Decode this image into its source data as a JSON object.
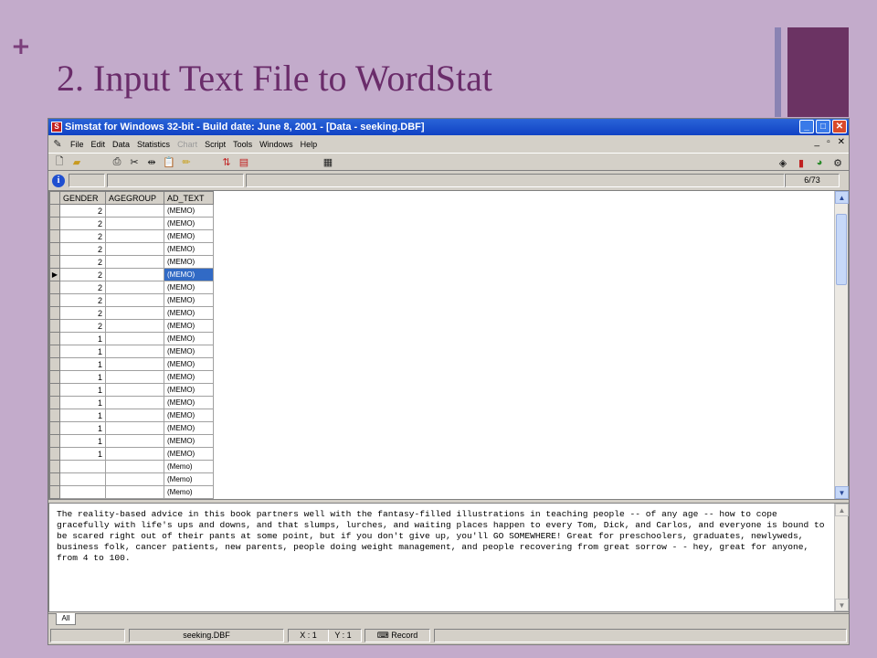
{
  "slide": {
    "plus": "+",
    "title": "2. Input Text File to WordStat"
  },
  "window": {
    "title": "Simstat for Windows 32-bit - Build date: June 8, 2001 - [Data - seeking.DBF]",
    "min": "_",
    "max": "□",
    "close": "✕"
  },
  "menu": [
    {
      "label": "File",
      "disabled": false
    },
    {
      "label": "Edit",
      "disabled": false
    },
    {
      "label": "Data",
      "disabled": false
    },
    {
      "label": "Statistics",
      "disabled": false
    },
    {
      "label": "Chart",
      "disabled": true
    },
    {
      "label": "Script",
      "disabled": false
    },
    {
      "label": "Tools",
      "disabled": false
    },
    {
      "label": "Windows",
      "disabled": false
    },
    {
      "label": "Help",
      "disabled": false
    }
  ],
  "mdi": {
    "min": "_",
    "restore": "▫",
    "close": "✕"
  },
  "toolbar": {
    "left_icons": [
      "new-file-icon",
      "open-folder-icon",
      "print-icon",
      "cut-icon",
      "split-icon",
      "paste-icon",
      "edit-icon",
      "sort-icon",
      "filter-icon",
      "table-icon"
    ],
    "right_icons": [
      "eraser-icon",
      "book-icon",
      "chart-icon",
      "settings-icon"
    ]
  },
  "info": {
    "icon": "i",
    "count": "6/73"
  },
  "grid": {
    "columns": [
      "GENDER",
      "AGEGROUP",
      "AD_TEXT"
    ],
    "current_row": 6,
    "selected_cell": {
      "row": 6,
      "col": "AD_TEXT"
    },
    "rows": [
      {
        "gender": "2",
        "agegroup": "",
        "ad_text": "(MEMO)"
      },
      {
        "gender": "2",
        "agegroup": "",
        "ad_text": "(MEMO)"
      },
      {
        "gender": "2",
        "agegroup": "",
        "ad_text": "(MEMO)"
      },
      {
        "gender": "2",
        "agegroup": "",
        "ad_text": "(MEMO)"
      },
      {
        "gender": "2",
        "agegroup": "",
        "ad_text": "(MEMO)"
      },
      {
        "gender": "2",
        "agegroup": "",
        "ad_text": "(MEMO)"
      },
      {
        "gender": "2",
        "agegroup": "",
        "ad_text": "(MEMO)"
      },
      {
        "gender": "2",
        "agegroup": "",
        "ad_text": "(MEMO)"
      },
      {
        "gender": "2",
        "agegroup": "",
        "ad_text": "(MEMO)"
      },
      {
        "gender": "2",
        "agegroup": "",
        "ad_text": "(MEMO)"
      },
      {
        "gender": "1",
        "agegroup": "",
        "ad_text": "(MEMO)"
      },
      {
        "gender": "1",
        "agegroup": "",
        "ad_text": "(MEMO)"
      },
      {
        "gender": "1",
        "agegroup": "",
        "ad_text": "(MEMO)"
      },
      {
        "gender": "1",
        "agegroup": "",
        "ad_text": "(MEMO)"
      },
      {
        "gender": "1",
        "agegroup": "",
        "ad_text": "(MEMO)"
      },
      {
        "gender": "1",
        "agegroup": "",
        "ad_text": "(MEMO)"
      },
      {
        "gender": "1",
        "agegroup": "",
        "ad_text": "(MEMO)"
      },
      {
        "gender": "1",
        "agegroup": "",
        "ad_text": "(MEMO)"
      },
      {
        "gender": "1",
        "agegroup": "",
        "ad_text": "(MEMO)"
      },
      {
        "gender": "1",
        "agegroup": "",
        "ad_text": "(MEMO)"
      },
      {
        "gender": "",
        "agegroup": "",
        "ad_text": "(Memo)"
      },
      {
        "gender": "",
        "agegroup": "",
        "ad_text": "(Memo)"
      },
      {
        "gender": "",
        "agegroup": "",
        "ad_text": "(Memo)"
      }
    ]
  },
  "memo": {
    "text": "The reality-based advice in this book partners well with the fantasy-filled illustrations in teaching people -- of any age -- how to cope gracefully with life's ups and downs, and that slumps, lurches, and waiting places happen to every Tom, Dick, and Carlos, and everyone is bound to be scared right out of their pants at some point, but if you don't give up, you'll GO SOMEWHERE! Great for preschoolers, graduates, newlyweds, business folk, cancer patients, new parents, people doing weight management, and people recovering from great sorrow - - hey, great for anyone, from 4 to 100."
  },
  "tabs": [
    {
      "label": "All"
    }
  ],
  "status": {
    "file": "seeking.DBF",
    "x": "X : 1",
    "y": "Y : 1",
    "record": "Record"
  },
  "colors": {
    "slide_bg": "#c3abcb",
    "title": "#6a2c6a",
    "titlebar": "#1042c4",
    "selection": "#316ac5"
  }
}
